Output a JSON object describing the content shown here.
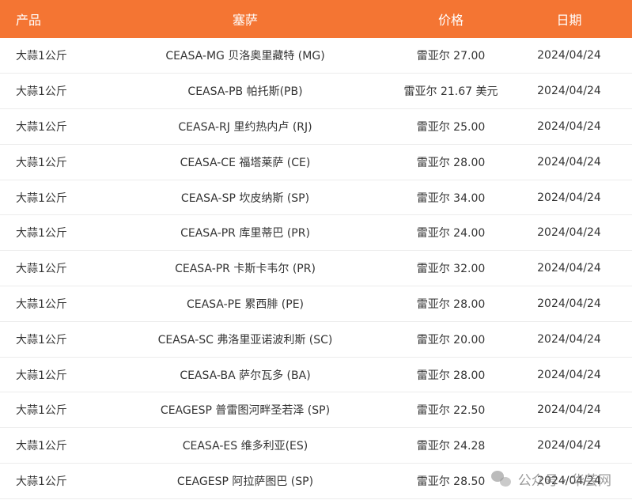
{
  "table": {
    "headers": [
      "产品",
      "塞萨",
      "价格",
      "日期"
    ],
    "rows": [
      {
        "product": "大蒜1公斤",
        "ceasa": "CEASA-MG 贝洛奥里藏特 (MG)",
        "price": "雷亚尔 27.00",
        "date": "2024/04/24"
      },
      {
        "product": "大蒜1公斤",
        "ceasa": "CEASA-PB 帕托斯(PB)",
        "price": "雷亚尔 21.67 美元",
        "date": "2024/04/24"
      },
      {
        "product": "大蒜1公斤",
        "ceasa": "CEASA-RJ 里约热内卢 (RJ)",
        "price": "雷亚尔 25.00",
        "date": "2024/04/24"
      },
      {
        "product": "大蒜1公斤",
        "ceasa": "CEASA-CE 福塔莱萨 (CE)",
        "price": "雷亚尔 28.00",
        "date": "2024/04/24"
      },
      {
        "product": "大蒜1公斤",
        "ceasa": "CEASA-SP 坎皮纳斯 (SP)",
        "price": "雷亚尔 34.00",
        "date": "2024/04/24"
      },
      {
        "product": "大蒜1公斤",
        "ceasa": "CEASA-PR 库里蒂巴 (PR)",
        "price": "雷亚尔 24.00",
        "date": "2024/04/24"
      },
      {
        "product": "大蒜1公斤",
        "ceasa": "CEASA-PR 卡斯卡韦尔 (PR)",
        "price": "雷亚尔 32.00",
        "date": "2024/04/24"
      },
      {
        "product": "大蒜1公斤",
        "ceasa": "CEASA-PE 累西腓 (PE)",
        "price": "雷亚尔 28.00",
        "date": "2024/04/24"
      },
      {
        "product": "大蒜1公斤",
        "ceasa": "CEASA-SC 弗洛里亚诺波利斯 (SC)",
        "price": "雷亚尔 20.00",
        "date": "2024/04/24"
      },
      {
        "product": "大蒜1公斤",
        "ceasa": "CEASA-BA 萨尔瓦多 (BA)",
        "price": "雷亚尔 28.00",
        "date": "2024/04/24"
      },
      {
        "product": "大蒜1公斤",
        "ceasa": "CEAGESP 普雷图河畔圣若泽 (SP)",
        "price": "雷亚尔 22.50",
        "date": "2024/04/24"
      },
      {
        "product": "大蒜1公斤",
        "ceasa": "CEASA-ES 维多利亚(ES)",
        "price": "雷亚尔 24.28",
        "date": "2024/04/24"
      },
      {
        "product": "大蒜1公斤",
        "ceasa": "CEAGESP 阿拉萨图巴 (SP)",
        "price": "雷亚尔 28.50",
        "date": "2024/04/24"
      }
    ]
  },
  "watermark": {
    "icon": "wechat-logo-icon",
    "text": "公众号 · 华芸网"
  },
  "colors": {
    "header_bg": "#f47533",
    "header_text": "#ffffff",
    "row_border": "#ececec"
  }
}
